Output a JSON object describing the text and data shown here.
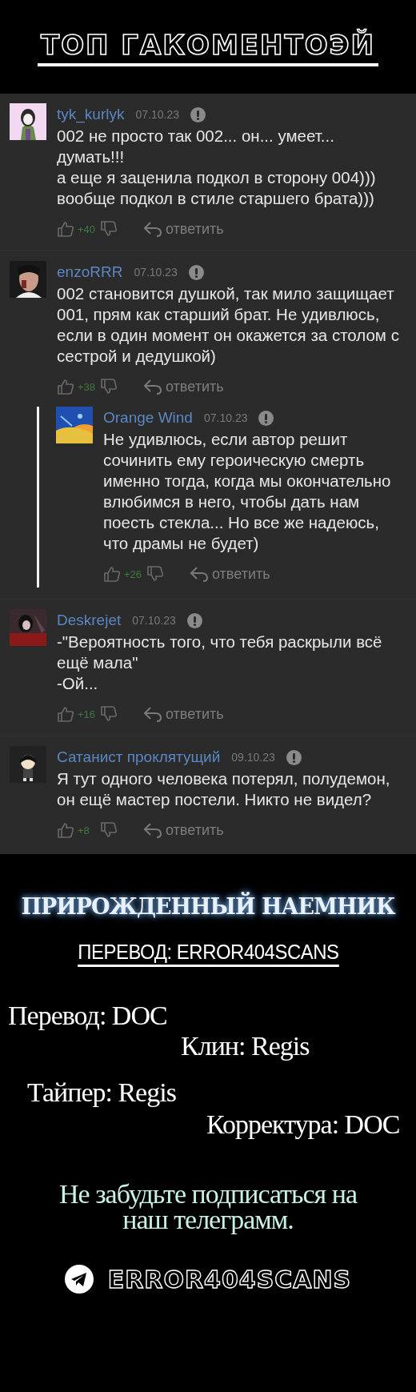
{
  "header": {
    "title": "ТОП ГАКОМЕНТОЭЙ"
  },
  "comments": [
    {
      "username": "tyk_kurlyk",
      "date": "07.10.23",
      "text": "002 не просто так 002... он... умеет... думать!!!\nа еще я заценила подкол в сторону 004)))\nвообще подкол в стиле старшего брата)))",
      "likes": "+40",
      "reply_label": "ответить"
    },
    {
      "username": "enzoRRR",
      "date": "07.10.23",
      "text": "002 становится душкой, так мило защищает 001, прям как старший брат. Не удивлюсь, если в один момент он окажется за столом с сестрой и дедушкой)",
      "likes": "+38",
      "reply_label": "ответить",
      "replies": [
        {
          "username": "Orange Wind",
          "date": "07.10.23",
          "text": "Не удивлюсь, если автор решит сочинить ему героическую смерть именно тогда, когда мы окончательно влюбимся в него, чтобы дать нам поесть стекла... Но все же надеюсь, что драмы не будет)",
          "likes": "+26",
          "reply_label": "ответить"
        }
      ]
    },
    {
      "username": "Deskrejet",
      "date": "07.10.23",
      "text": "-\"Вероятность того, что тебя раскрыли всё ещё мала\"\n-Ой...",
      "likes": "+16",
      "reply_label": "ответить"
    },
    {
      "username": "Сатанист проклятущий",
      "date": "09.10.23",
      "text": "Я тут одного человека потерял, полудемон, он ещё мастер постели. Никто не видел?",
      "likes": "+8",
      "reply_label": "ответить"
    }
  ],
  "credits": {
    "title": "ПРИРОЖДЕННЫЙ НАЕМНИК",
    "team": "ПЕРЕВОД: ERROR404SCANS",
    "roles": [
      "Перевод: DOC",
      "Клин: Regis",
      "Тайпер: Regis",
      "Корректура: DOC"
    ],
    "reminder": "Не забудьте подписаться на наш телеграмм.",
    "telegram": "ERROR404SCANS"
  }
}
